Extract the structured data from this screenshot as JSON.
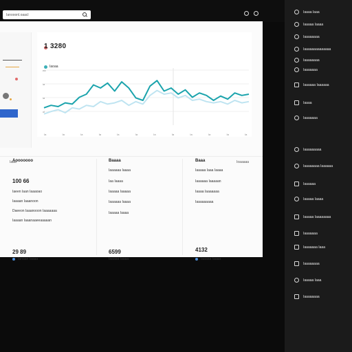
{
  "search": {
    "text": "Ianooonl.oaacl"
  },
  "chart": {
    "value": "1 3280",
    "legend": "Iaoaa",
    "y_ticks": [
      "ea",
      "la",
      "la",
      "ol"
    ],
    "x_ticks": [
      "Ia",
      "Ia",
      "Ia",
      "Ia",
      "Ia",
      "Ia",
      "Ia",
      "Ia",
      "Ia",
      "Ia",
      "Ia",
      "Ia"
    ],
    "colors": {
      "line1": "#1aa3ac",
      "line2": "#bfe4f1"
    }
  },
  "chart_data": {
    "type": "line",
    "title": "",
    "xlabel": "",
    "ylabel": "",
    "ylim": [
      0,
      100
    ],
    "x": [
      1,
      2,
      3,
      4,
      5,
      6,
      7,
      8,
      9,
      10,
      11,
      12,
      13,
      14,
      15,
      16,
      17,
      18,
      19,
      20,
      21,
      22,
      23,
      24,
      25,
      26,
      27,
      28,
      29,
      30
    ],
    "series": [
      {
        "values": [
          28,
          32,
          30,
          36,
          34,
          45,
          50,
          65,
          60,
          68,
          55,
          70,
          60,
          44,
          40,
          63,
          72,
          55,
          60,
          50,
          57,
          45,
          52,
          48,
          40,
          47,
          42,
          52,
          48,
          50
        ]
      },
      {
        "values": [
          18,
          22,
          25,
          20,
          28,
          26,
          32,
          30,
          38,
          34,
          36,
          40,
          32,
          38,
          34,
          48,
          56,
          50,
          52,
          44,
          48,
          40,
          42,
          38,
          36,
          38,
          34,
          40,
          36,
          38
        ]
      }
    ]
  },
  "rows": {
    "left": "Iaaa",
    "right": "Ioaaaaa"
  },
  "col1": {
    "title": "Aooooooo",
    "big": "100 66",
    "lines": [
      "Iaeen Iaan Iaaaoao",
      "Iaaaan Iaaanoon",
      "Daeeon Iaaanooon Iaaaaaaa",
      "Iaaaan Iaaanaaeeaaaaan"
    ],
    "big2": "29 89",
    "foot": "Ianaan Iaaaa"
  },
  "col2": {
    "title": "Baaaa",
    "lines": [
      "Iaaaaaa Iaaaa",
      "Iaa Iaaaa",
      "Iaaaaa Iaaaaa",
      "Iaaaaaa Iaaaa",
      "Iaaaaa Iaaaa"
    ],
    "big2": "6599",
    "foot": "Iaaaaa Iaaaa"
  },
  "col3": {
    "title": "Baaa",
    "lines": [
      "Iaaaaa Iaaa Iaaaa",
      "Iaaaaaa Iaaaaan",
      "Iaaaa Iaaaaaaa",
      "Iaaaaaaaaa"
    ],
    "big2": "4132",
    "foot": "Iaaaaa Iaaaa"
  },
  "sidebar": {
    "items": [
      {
        "label": "Iaaaa Iaaa",
        "icon": "circle-icon"
      },
      {
        "label": "Iaaaaa Iaaaa",
        "icon": "circle-icon"
      },
      {
        "label": "Iaaaaaaaa",
        "icon": "circle-icon"
      },
      {
        "label": "Iaaaaaaaaaaaaaa",
        "icon": "circle-icon"
      },
      {
        "label": "Iaaaaaaaa",
        "icon": "circle-icon"
      },
      {
        "label": "Iaaaaaaa",
        "icon": "circle-icon"
      },
      {
        "label": "Iaaaaaa Iaaaaaa",
        "icon": "square-icon"
      },
      {
        "label": "Iaaaa",
        "icon": "square-icon"
      },
      {
        "label": "Iaaaaaaa",
        "icon": "circle-icon"
      },
      {
        "label": "Iaaaaaaaaa",
        "icon": "circle-icon"
      },
      {
        "label": "Iaaaaaaaa Iaaaaaa",
        "icon": "circle-icon"
      },
      {
        "label": "Iaaaaaa",
        "icon": "square-icon"
      },
      {
        "label": "Iaaaaa Iaaaa",
        "icon": "circle-icon"
      },
      {
        "label": "Iaaaaa Iaaaaaaaa",
        "icon": "square-icon"
      },
      {
        "label": "Iaaaaaaa",
        "icon": "square-icon"
      },
      {
        "label": "Iaaaaaaa Iaaa",
        "icon": "square-icon"
      },
      {
        "label": "Iaaaaaaaa",
        "icon": "square-icon"
      },
      {
        "label": "Iaaaaa Iaaa",
        "icon": "circle-icon"
      },
      {
        "label": "Iaaaaaaaa",
        "icon": "square-icon"
      }
    ]
  }
}
